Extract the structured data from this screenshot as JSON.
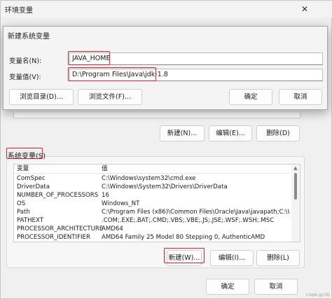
{
  "outer_window": {
    "title": "环境变量",
    "close_symbol": "✕"
  },
  "user_vars": {
    "new_button": "新建(N)...",
    "edit_button": "编辑(E)...",
    "delete_button": "删除(D)"
  },
  "system_vars": {
    "group_label": "系统变量(S)",
    "columns": [
      "变量",
      "值"
    ],
    "rows": [
      {
        "name": "ComSpec",
        "value": "C:\\Windows\\system32\\cmd.exe"
      },
      {
        "name": "DriverData",
        "value": "C:\\Windows\\System32\\Drivers\\DriverData"
      },
      {
        "name": "NUMBER_OF_PROCESSORS",
        "value": "16"
      },
      {
        "name": "OS",
        "value": "Windows_NT"
      },
      {
        "name": "Path",
        "value": "C:\\Program Files (x86)\\Common Files\\Oracle\\Java\\javapath;C:\\Win..."
      },
      {
        "name": "PATHEXT",
        "value": ".COM;.EXE;.BAT;.CMD;.VBS;.VBE;.JS;.JSE;.WSF;.WSH;.MSC"
      },
      {
        "name": "PROCESSOR_ARCHITECTURE",
        "value": "AMD64"
      },
      {
        "name": "PROCESSOR_IDENTIFIER",
        "value": "AMD64 Family 25 Model 80 Stepping 0, AuthenticAMD"
      }
    ],
    "new_button": "新建(W)...",
    "edit_button": "编辑(I)...",
    "delete_button": "删除(L)"
  },
  "footer": {
    "ok_button": "确定",
    "cancel_button": "取消"
  },
  "dialog": {
    "title": "新建系统变量",
    "name_label": "变量名(N):",
    "name_value": "JAVA_HOME",
    "value_label": "变量值(V):",
    "value_value": "D:\\Program Files\\Java\\jdk-1.8",
    "browse_dir_button": "浏览目录(D)...",
    "browse_file_button": "浏览文件(F)...",
    "ok_button": "确定",
    "cancel_button": "取消"
  },
  "watermark": "CSDN @小叻",
  "colors": {
    "highlight_red": "#e02020"
  }
}
